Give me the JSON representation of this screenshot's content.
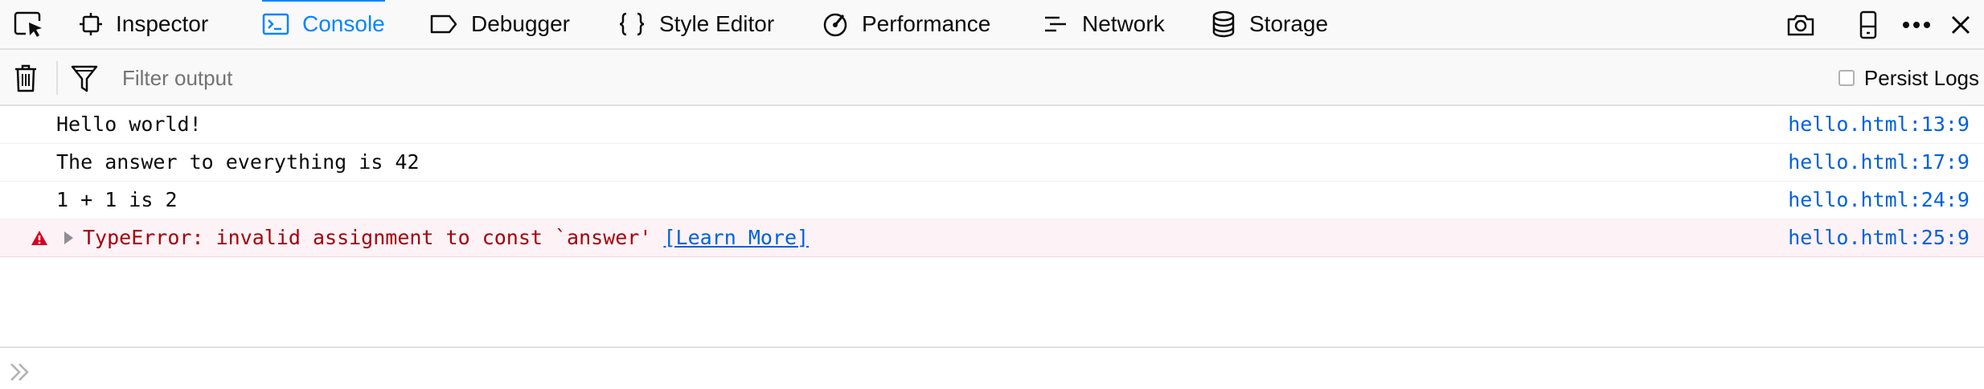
{
  "tabs": [
    {
      "label": "Inspector"
    },
    {
      "label": "Console",
      "selected": true
    },
    {
      "label": "Debugger"
    },
    {
      "label": "Style Editor"
    },
    {
      "label": "Performance"
    },
    {
      "label": "Network"
    },
    {
      "label": "Storage"
    }
  ],
  "icons": {
    "picker": "element-picker-icon",
    "screenshot": "camera-icon",
    "responsive": "responsive-mode-icon",
    "more": "more-options-icon",
    "close": "close-icon",
    "clear": "trash-icon",
    "filter": "filter-icon",
    "error": "error-warning-icon",
    "twisty": "expand-arrow-icon",
    "prompt": "double-chevron-icon"
  },
  "toolbar": {
    "filter_placeholder": "Filter output",
    "persist_label": "Persist Logs",
    "persist_checked": false
  },
  "messages": [
    {
      "text": "Hello world!",
      "location": "hello.html:13:9",
      "level": "log"
    },
    {
      "text": "The answer to everything is 42",
      "location": "hello.html:17:9",
      "level": "log"
    },
    {
      "text": "1 + 1 is 2",
      "location": "hello.html:24:9",
      "level": "log"
    },
    {
      "text": "TypeError: invalid assignment to const `answer' ",
      "link": "[Learn More]",
      "location": "hello.html:25:9",
      "level": "error"
    }
  ],
  "colors": {
    "accent": "#0a84ff",
    "link": "#0060df",
    "error_text": "#a4000f",
    "error_icon": "#d70022",
    "error_bg": "#fdf2f5"
  }
}
